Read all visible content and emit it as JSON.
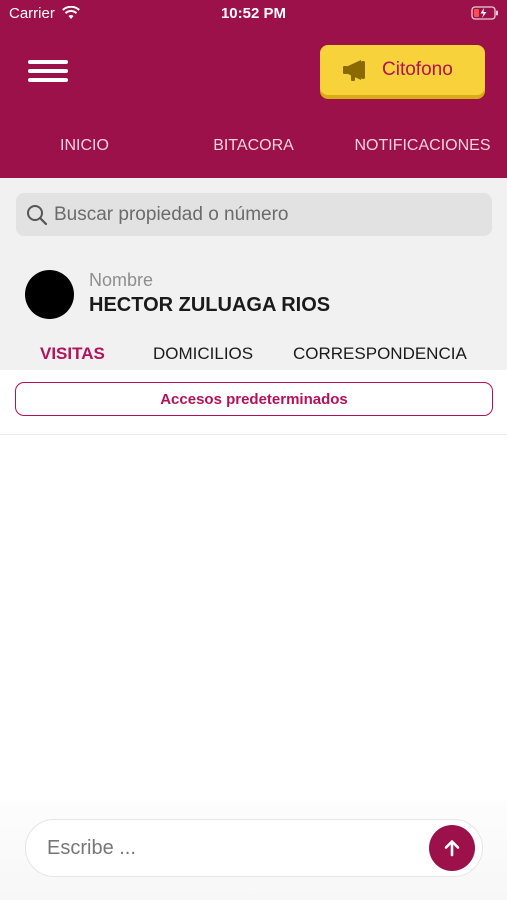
{
  "status_bar": {
    "carrier": "Carrier",
    "time": "10:52 PM"
  },
  "header": {
    "citofono_label": "Citofono",
    "tabs": [
      "INICIO",
      "BITACORA",
      "NOTIFICACIONES"
    ]
  },
  "search": {
    "placeholder": "Buscar propiedad o número"
  },
  "profile": {
    "label": "Nombre",
    "name": "HECTOR ZULUAGA RIOS"
  },
  "sub_tabs": {
    "items": [
      "VISITAS",
      "DOMICILIOS",
      "CORRESPONDENCIA"
    ],
    "active": "VISITAS"
  },
  "accesos_label": "Accesos predeterminados",
  "composer": {
    "placeholder": "Escribe ..."
  },
  "colors": {
    "primary": "#9c1149",
    "accent": "#b3125a",
    "button_yellow": "#f7d23a"
  },
  "icons": [
    "menu-icon",
    "megaphone-icon",
    "search-icon",
    "wifi-icon",
    "battery-icon",
    "arrow-up-icon"
  ]
}
